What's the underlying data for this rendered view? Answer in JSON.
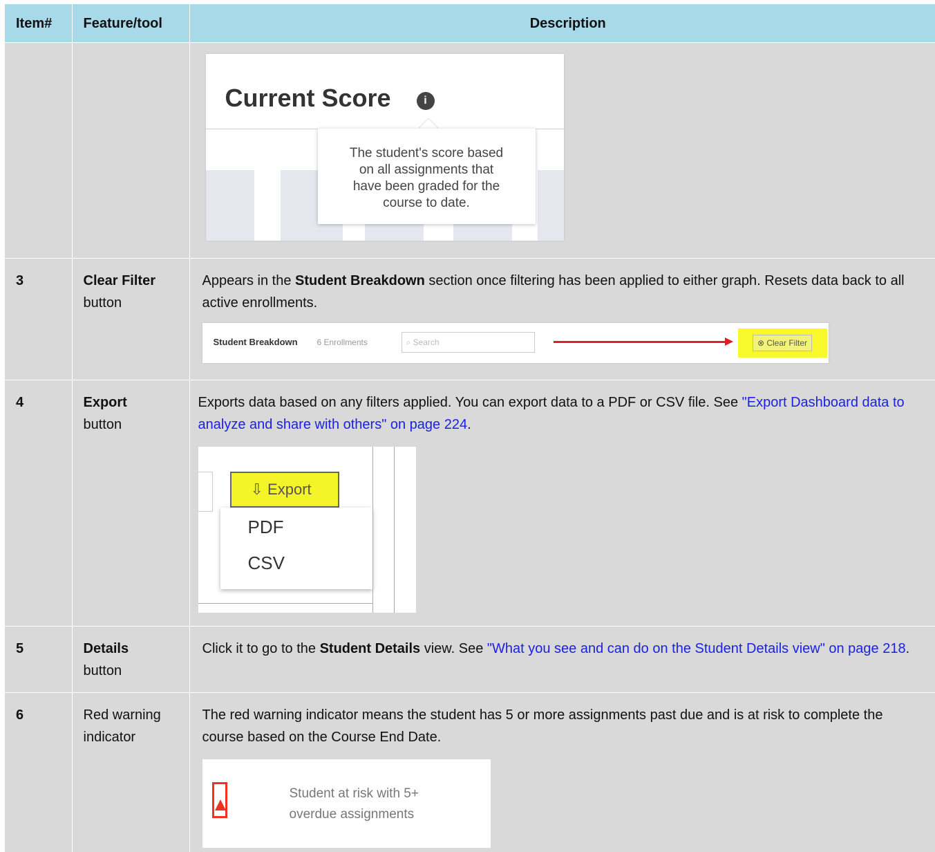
{
  "table": {
    "headers": [
      "Item#",
      "Feature/tool",
      "Description"
    ]
  },
  "row_score": {
    "title": "Current Score",
    "info_symbol": "i",
    "tooltip_lines": [
      "The student's score based",
      "on all assignments that",
      "have been graded for the",
      "course to date."
    ]
  },
  "row3": {
    "num": "3",
    "feature_bold": "Clear Filter",
    "feature_rest": "button",
    "desc": [
      "Appears in the ",
      "Student Breakdown",
      " section once filtering has been applied to either graph. Resets data back to all active enrollments."
    ],
    "shot": {
      "section_label": "Student Breakdown",
      "enrollments": "6 Enrollments",
      "search_placeholder": "Search",
      "clear_label": "Clear Filter"
    }
  },
  "row4": {
    "num": "4",
    "feature_bold": "Export",
    "feature_rest": "button",
    "desc": "Exports data based on any filters applied. You can export data to a PDF or CSV file. See ",
    "link": "\"Export Dashboard data to analyze and share with others\" on page 224",
    "desc_end": ".",
    "shot": {
      "export_label": "Export",
      "menu": [
        "PDF",
        "CSV"
      ]
    }
  },
  "row5": {
    "num": "5",
    "feature_bold": "Details",
    "feature_rest": "button",
    "desc": [
      "Click it to go to the ",
      "Student Details",
      " view. See "
    ],
    "link": "\"What you see and can do on the Student Details view\" on page 218",
    "desc_end": "."
  },
  "row6": {
    "num": "6",
    "feature_line1": "Red warning",
    "feature_line2": "indicator",
    "desc": "The red warning indicator means the student has 5 or more assignments past due and is at risk to complete the course based on the Course End Date.",
    "shot": {
      "line1": "Student at risk with 5+",
      "line2": "overdue assignments"
    }
  },
  "colors": {
    "header_bg": "#a8d9e8",
    "cell_bg": "#d9d9d9",
    "link": "#1a22e0",
    "highlight": "#f4f428",
    "warning": "#e32222"
  }
}
